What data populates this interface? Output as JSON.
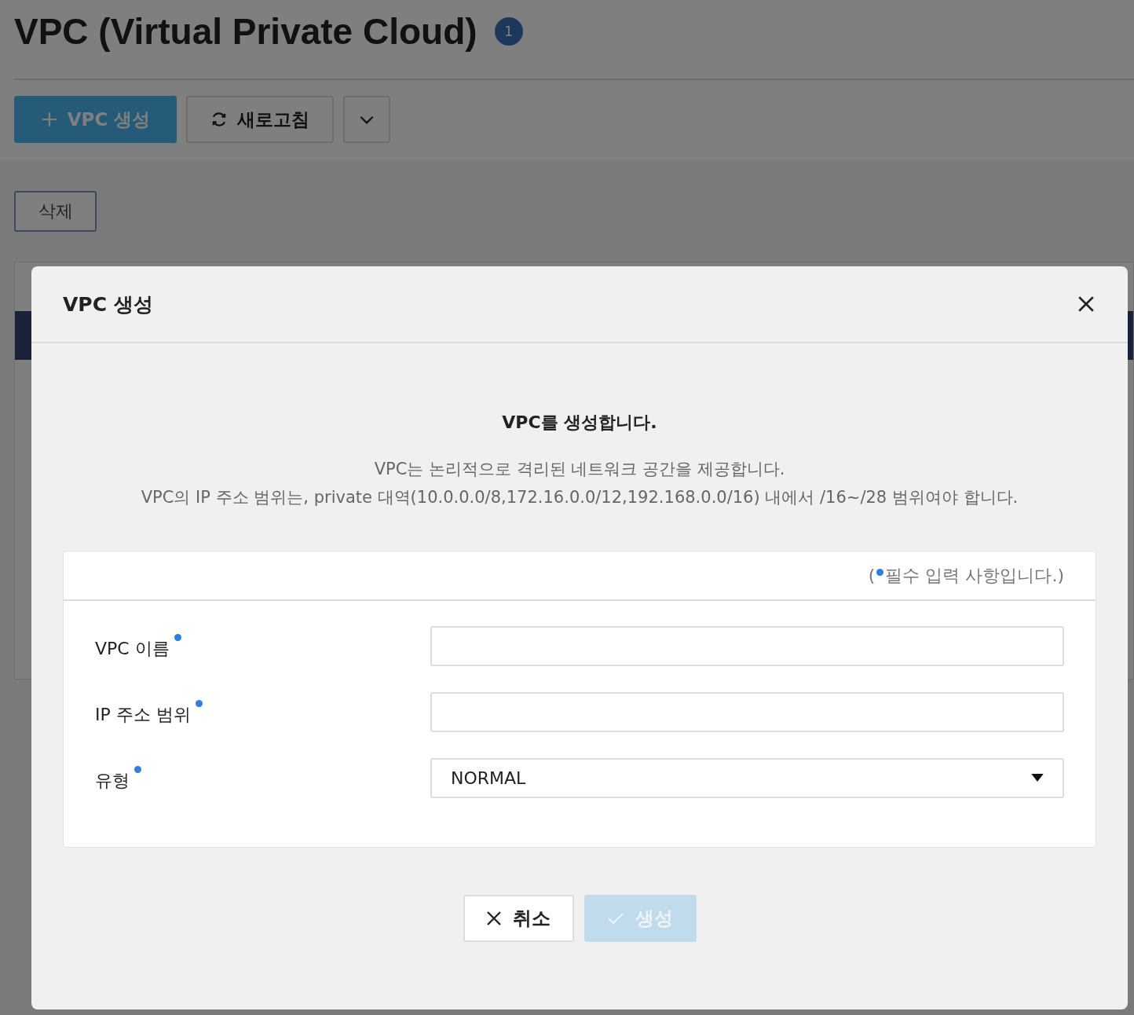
{
  "page": {
    "title": "VPC (Virtual Private Cloud)",
    "count": "1",
    "create_label": "VPC 생성",
    "refresh_label": "새로고침",
    "delete_label": "삭제"
  },
  "dialog": {
    "title": "VPC 생성",
    "heading": "VPC를 생성합니다.",
    "description": [
      "VPC는 논리적으로 격리된 네트워크 공간을 제공합니다.",
      "VPC의 IP 주소 범위는, private 대역(10.0.0.0/8,172.16.0.0/12,192.168.0.0/16) 내에서 /16~/28 범위여야 합니다."
    ],
    "note_open": "(",
    "note_text": "필수 입력 사항입니다.)",
    "fields": [
      {
        "kind": "text",
        "label": "VPC 이름",
        "required": true
      },
      {
        "kind": "text",
        "label": "IP 주소 범위",
        "required": true
      },
      {
        "kind": "select",
        "label": "유형",
        "required": true,
        "value": "NORMAL"
      }
    ],
    "buttons": [
      {
        "kind": "cancel",
        "label": "취소",
        "disabled": false
      },
      {
        "kind": "submit",
        "label": "생성",
        "disabled": true
      }
    ]
  }
}
